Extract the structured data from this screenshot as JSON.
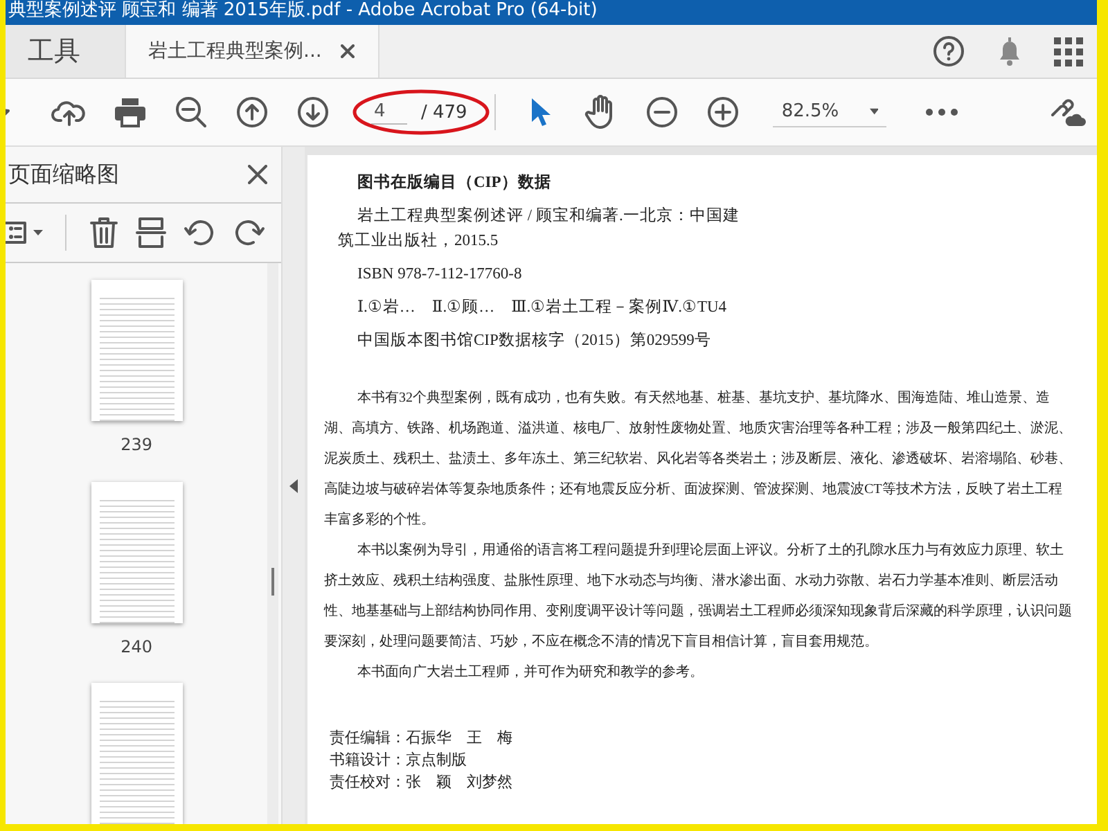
{
  "window": {
    "title": "典型案例述评 顾宝和 编著 2015年版.pdf - Adobe Acrobat Pro (64-bit)"
  },
  "tabs": [
    {
      "kind": "home",
      "label": "工具",
      "selected": false
    },
    {
      "kind": "document",
      "label": "岩土工程典型案例...",
      "selected": true
    }
  ],
  "toolbar": {
    "page_number": "4",
    "page_total": "/ 479",
    "zoom": "82.5%"
  },
  "thumbnails_pane": {
    "title": "页面缩略图",
    "pages": [
      "239",
      "240"
    ]
  },
  "document": {
    "heading": "图书在版编目（CIP）数据",
    "cip_lines": [
      "岩土工程典型案例述评 / 顾宝和编著.一北京：中国建筑工业出版社，2015.5",
      "ISBN 978-7-112-17760-8",
      "Ⅰ.①岩…　Ⅱ.①顾…　Ⅲ.①岩土工程－案例Ⅳ.①TU4",
      "中国版本图书馆CIP数据核字（2015）第029599号"
    ],
    "paragraphs": [
      "本书有32个典型案例，既有成功，也有失败。有天然地基、桩基、基坑支护、基坑降水、围海造陆、堆山造景、造湖、高填方、铁路、机场跑道、溢洪道、核电厂、放射性废物处置、地质灾害治理等各种工程；涉及一般第四纪土、淤泥、泥炭质土、残积土、盐渍土、多年冻土、第三纪软岩、风化岩等各类岩土；涉及断层、液化、渗透破坏、岩溶塌陷、砂巷、高陡边坡与破碎岩体等复杂地质条件；还有地震反应分析、面波探测、管波探测、地震波CT等技术方法，反映了岩土工程丰富多彩的个性。",
      "本书以案例为导引，用通俗的语言将工程问题提升到理论层面上评议。分析了土的孔隙水压力与有效应力原理、软土挤土效应、残积土结构强度、盐胀性原理、地下水动态与均衡、潜水渗出面、水动力弥散、岩石力学基本准则、断层活动性、地基基础与上部结构协同作用、变刚度调平设计等问题，强调岩土工程师必须深知现象背后深藏的科学原理，认识问题要深刻，处理问题要简洁、巧妙，不应在概念不清的情况下盲目相信计算，盲目套用规范。",
      "本书面向广大岩土工程师，并可作为研究和教学的参考。"
    ],
    "credits": [
      "责任编辑：石振华　王　梅",
      "书籍设计：京点制版",
      "责任校对：张　颖　刘梦然"
    ]
  }
}
